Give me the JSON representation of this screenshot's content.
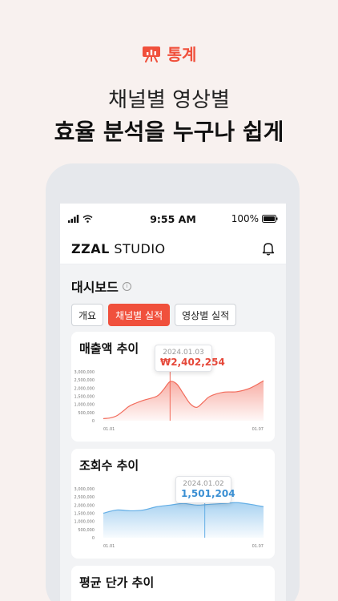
{
  "promo": {
    "badge_icon": "chart-board-icon",
    "badge_label": "통계",
    "headline_line1": "채널별 영상별",
    "headline_line2": "효율 분석을 누구나 쉽게"
  },
  "status_bar": {
    "time": "9:55 AM",
    "battery": "100%"
  },
  "header": {
    "logo_bold": "ZZAL",
    "logo_rest": "STUDIO",
    "notification_icon": "bell-icon"
  },
  "page": {
    "title": "대시보드",
    "tabs": [
      {
        "label": "개요",
        "active": false
      },
      {
        "label": "채널별 실적",
        "active": true
      },
      {
        "label": "영상별 실적",
        "active": false
      }
    ]
  },
  "colors": {
    "accent": "#f0503c",
    "revenue_line": "#f26b5b",
    "views_line": "#63aee6",
    "views_value": "#3a8fd3"
  },
  "chart_data": [
    {
      "type": "area",
      "title": "매출액 추이",
      "ylim": [
        0,
        3000000
      ],
      "yticks": [
        "3,000,000",
        "2,500,000",
        "2,000,000",
        "1,500,000",
        "1,000,000",
        "500,000",
        "0"
      ],
      "xticks": [
        "01.01",
        "01.07"
      ],
      "x": [
        0,
        0.25,
        0.5,
        0.75,
        1,
        1.5,
        2,
        2.25,
        2.5,
        2.75,
        3,
        3.25,
        3.5,
        3.75,
        4,
        4.5,
        5,
        5.5,
        6
      ],
      "values": [
        130000,
        170000,
        300000,
        600000,
        920000,
        1250000,
        1500000,
        1900000,
        2402254,
        2250000,
        1650000,
        1050000,
        820000,
        1150000,
        1500000,
        1750000,
        1780000,
        2000000,
        2450000
      ],
      "tooltip": {
        "date": "2024.01.03",
        "value": "₩2,402,254",
        "x": 2.5
      }
    },
    {
      "type": "area",
      "title": "조회수 추이",
      "ylim": [
        0,
        3000000
      ],
      "yticks": [
        "3,000,000",
        "2,500,000",
        "2,000,000",
        "1,500,000",
        "1,000,000",
        "500,000",
        "0"
      ],
      "xticks": [
        "01.01",
        "01.07"
      ],
      "x": [
        0,
        0.5,
        1,
        1.5,
        2,
        2.5,
        3,
        3.5,
        4,
        4.5,
        5,
        5.5,
        6
      ],
      "values": [
        1500000,
        1700000,
        1650000,
        1700000,
        1900000,
        2000000,
        2100000,
        2000000,
        2050000,
        2100000,
        2150000,
        2050000,
        1900000
      ],
      "tooltip": {
        "date": "2024.01.02",
        "value": "1,501,204",
        "x": 3.8
      }
    },
    {
      "type": "area",
      "title": "평균 단가 추이"
    }
  ]
}
